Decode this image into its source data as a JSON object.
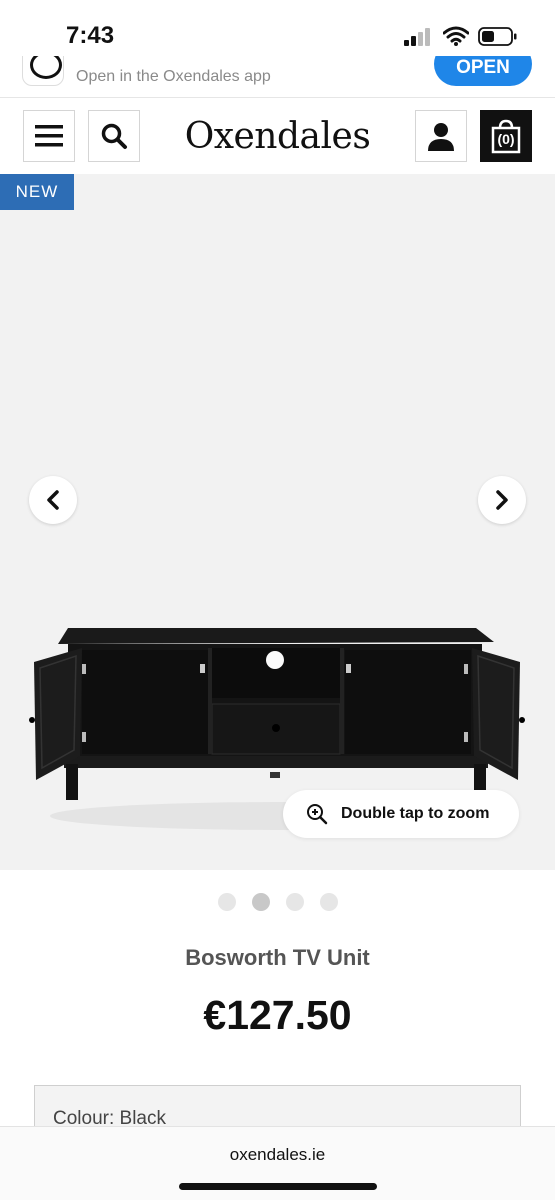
{
  "status_bar": {
    "time": "7:43"
  },
  "app_banner": {
    "text": "Open in the Oxendales app",
    "open_label": "OPEN"
  },
  "header": {
    "brand": "Oxendales",
    "bag_count": "(0)"
  },
  "gallery": {
    "badge": "NEW",
    "zoom_hint": "Double tap to zoom",
    "image_count": 4,
    "active_index": 1
  },
  "product": {
    "title": "Bosworth TV Unit",
    "price": "€127.50",
    "colour_label": "Colour: Black"
  },
  "browser": {
    "url": "oxendales.ie"
  },
  "colors": {
    "accent_blue": "#1f86e8",
    "badge_blue": "#2d6db5",
    "dark": "#111111"
  }
}
